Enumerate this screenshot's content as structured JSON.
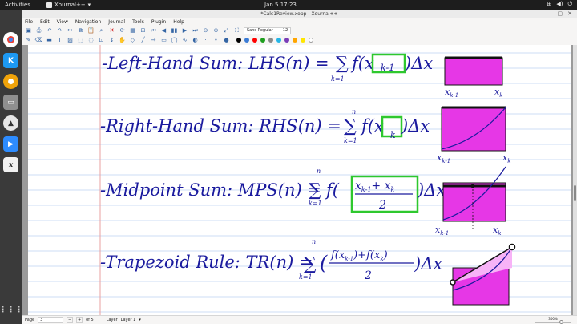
{
  "system": {
    "activities": "Activities",
    "app_name": "Xournal++",
    "clock": "Jan 5  17:23"
  },
  "window": {
    "title": "*Calc1Review.xopp - Xournal++"
  },
  "menu": [
    "File",
    "Edit",
    "View",
    "Navigation",
    "Journal",
    "Tools",
    "Plugin",
    "Help"
  ],
  "toolbar": {
    "font_name": "Sans Regular",
    "font_size": "12",
    "colors": [
      "#000000",
      "#3a7bd5",
      "#ff0000",
      "#1e9e1e",
      "#8a8a8a",
      "#25b5e6",
      "#7a3db8",
      "#ffa500",
      "#ffe600",
      "#ffffff"
    ]
  },
  "status": {
    "page_label": "Page",
    "page_value": "3",
    "of_label": "of 5",
    "layer_label": "Layer",
    "layer_value": "Layer 1",
    "zoom": "300%"
  },
  "notes": {
    "line1": "-Left-Hand Sum: LHS(n) = ",
    "line1_sum_top": "n",
    "line1_sum_bottom": "k=1",
    "line1_term": "f(x",
    "line1_sub": "k-1",
    "line1_end": ")Δx",
    "line1_axis_a": "x",
    "line1_axis_a_sub": "k-1",
    "line1_axis_b": "x",
    "line1_axis_b_sub": "k",
    "line2": "-Right-Hand Sum: RHS(n) = ",
    "line2_sum_top": "n",
    "line2_sum_bottom": "k=1",
    "line2_term": "f(x",
    "line2_sub": "k",
    "line2_end": ")Δx",
    "line2_axis_a": "x",
    "line2_axis_a_sub": "k-1",
    "line2_axis_b": "x",
    "line2_axis_b_sub": "k",
    "line3": "-Midpoint Sum: MPS(n) = ",
    "line3_sum_top": "n",
    "line3_sum_bottom": "k=1",
    "line3_num": "x",
    "line3_num_sub1": "k-1",
    "line3_num_plus": "+ x",
    "line3_num_sub2": "k",
    "line3_den": "2",
    "line3_end": ")Δx",
    "line3_axis_a": "x",
    "line3_axis_a_sub": "k-1",
    "line3_axis_b": "x",
    "line3_axis_b_sub": "k",
    "line4": "-Trapezoid Rule: TR(n) = ",
    "line4_sum_top": "n",
    "line4_sum_bottom": "k=1",
    "line4_num": "f(x",
    "line4_num_sub1": "k-1",
    "line4_num_mid": ")+f(x",
    "line4_num_sub2": "k",
    "line4_num_end": ")",
    "line4_den": "2",
    "line4_end": ")Δx"
  }
}
